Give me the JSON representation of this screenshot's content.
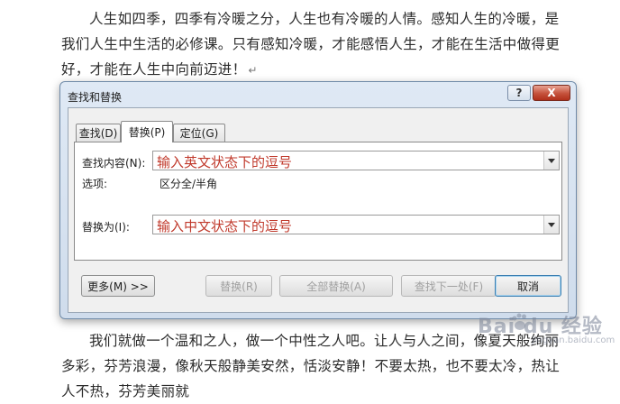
{
  "document": {
    "para1": "人生如四季，四季有冷暖之分，人生也有冷暖的人情。感知人生的冷暖，是我们人生中生活的必修课。只有感知冷暖，才能感悟人生，才能在生活中做得更好，才能在人生中向前迈进！",
    "para_mark": "↵",
    "para2": "我们就做一个温和之人，做一个中性之人吧。让人与人之间，像夏天般绚丽多彩，芬芳浪漫，像秋天般静美安然，恬淡安静！不要太热，也不要太冷，热让人不热，芬芳美丽就"
  },
  "dialog": {
    "title": "查找和替换",
    "help_label": "?",
    "close_label": "X",
    "tabs": [
      {
        "label": "查找(D)",
        "active": false
      },
      {
        "label": "替换(P)",
        "active": true
      },
      {
        "label": "定位(G)",
        "active": false
      }
    ],
    "find": {
      "label": "查找内容(N):",
      "value": "输入英文状态下的逗号"
    },
    "options": {
      "label": "选项:",
      "value": "区分全/半角"
    },
    "replace": {
      "label": "替换为(I):",
      "value": "输入中文状态下的逗号"
    },
    "buttons": {
      "more": "更多(M) >>",
      "replace": "替换(R)",
      "replace_all": "全部替换(A)",
      "find_next": "查找下一处(F)",
      "cancel": "取消"
    }
  },
  "watermark": {
    "brand": "Bai du 经验",
    "sub": "jingyan.baidu.com"
  }
}
